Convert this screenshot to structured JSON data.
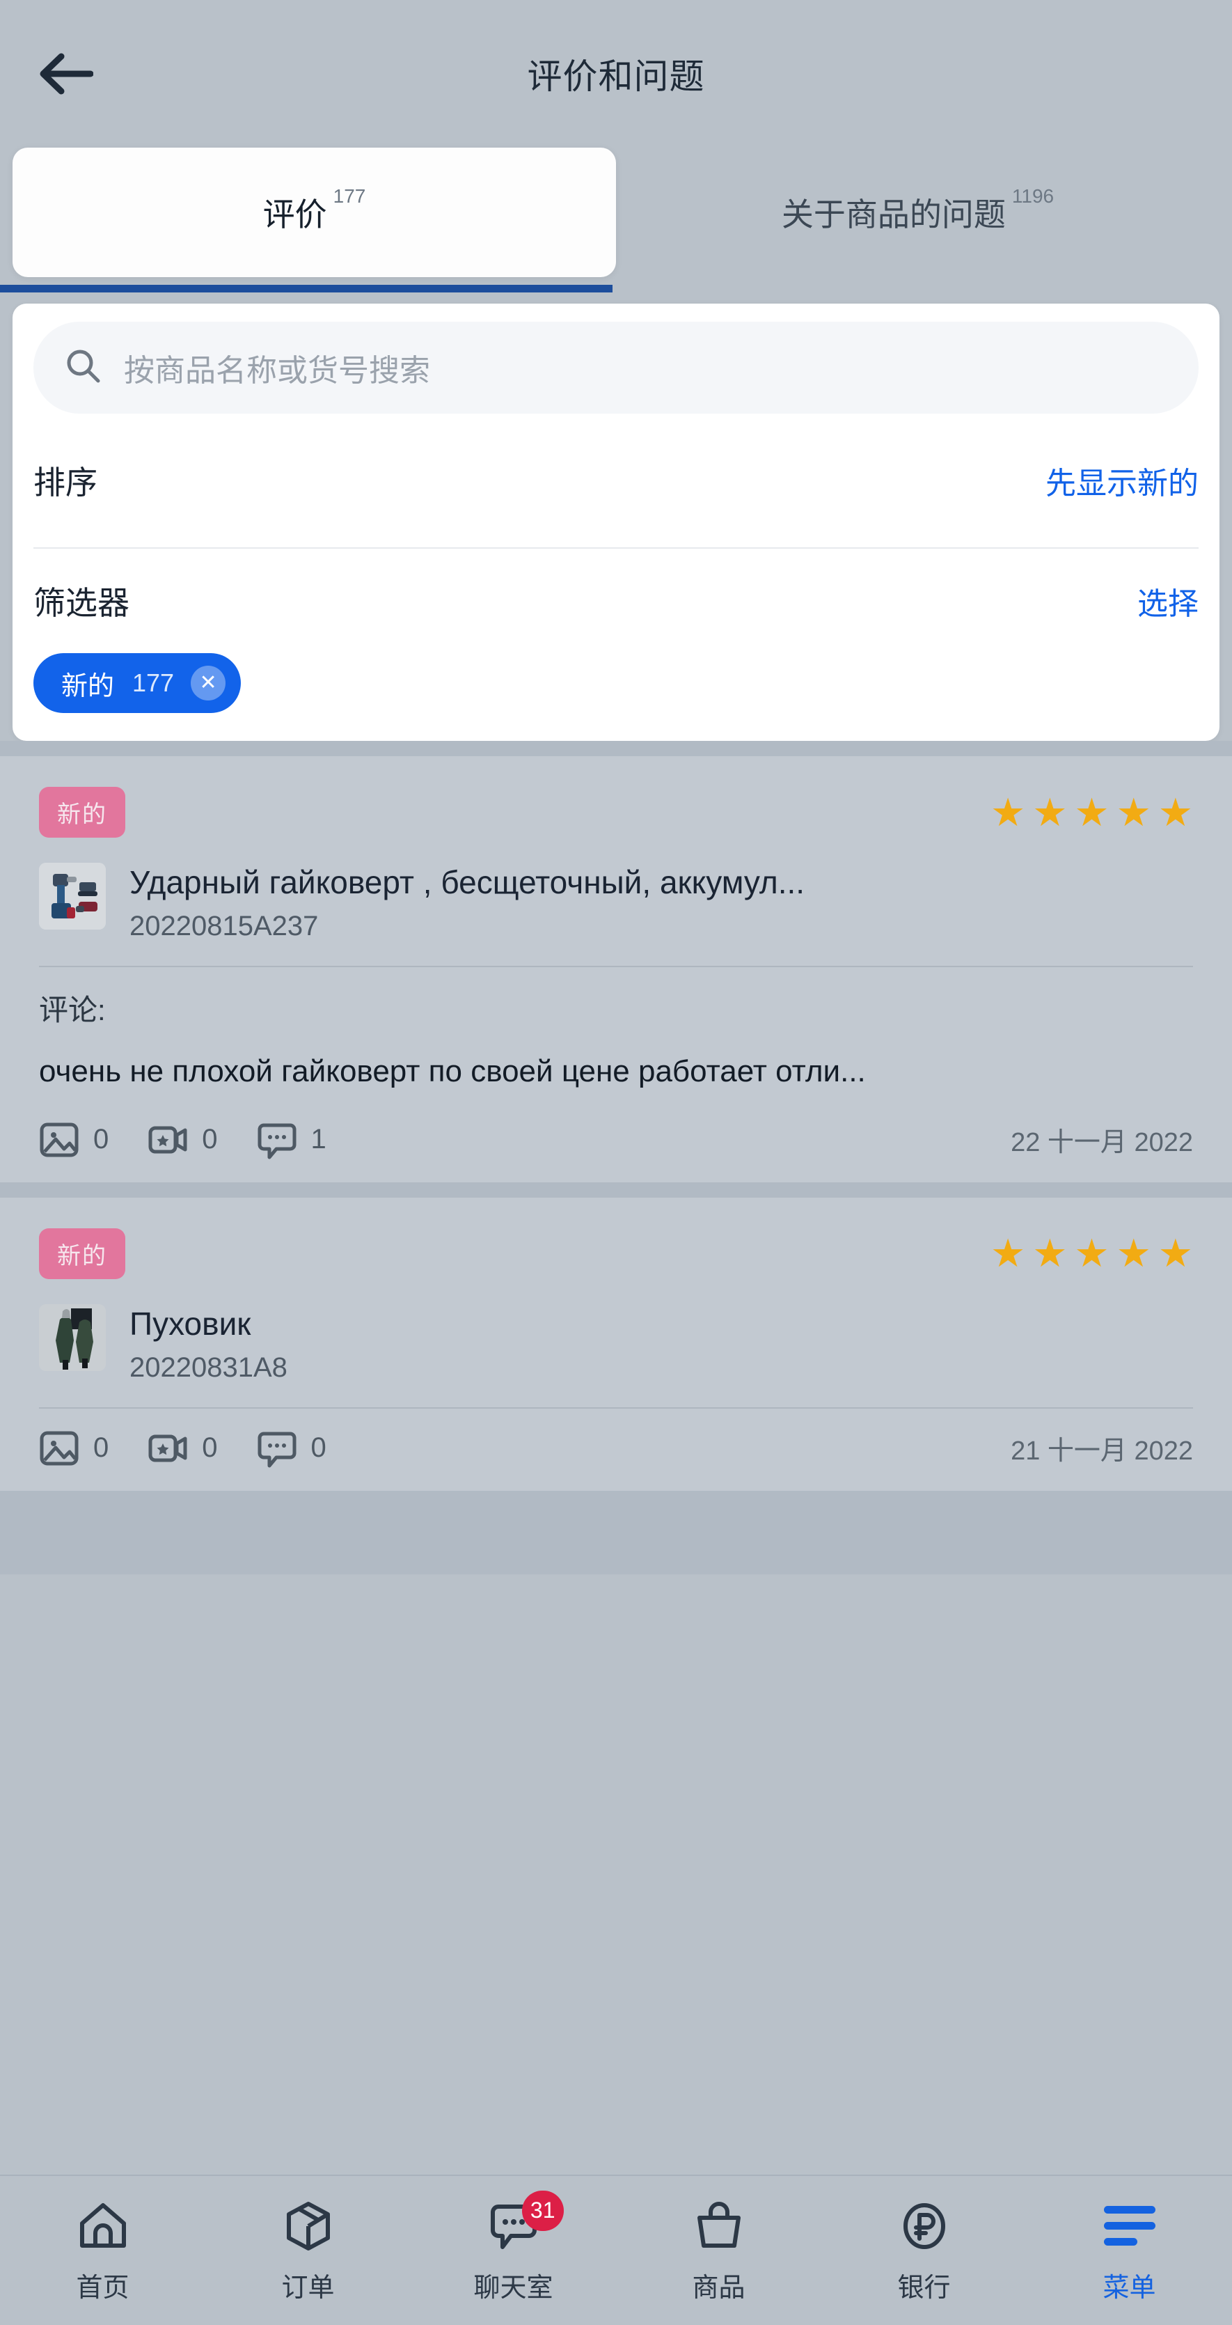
{
  "header": {
    "back_icon": "back-arrow-icon",
    "title": "评价和问题"
  },
  "tabs": [
    {
      "label": "评价",
      "count": "177",
      "active": true
    },
    {
      "label": "关于商品的问题",
      "count": "1196",
      "active": false
    }
  ],
  "filter_panel": {
    "search": {
      "icon": "search-icon",
      "placeholder": "按商品名称或货号搜索",
      "value": ""
    },
    "sort": {
      "label": "排序",
      "value": "先显示新的"
    },
    "filters": {
      "label": "筛选器",
      "action": "选择"
    },
    "chips": [
      {
        "label": "新的",
        "count": "177",
        "close_icon": "close-icon"
      }
    ]
  },
  "reviews": [
    {
      "badge": "新的",
      "rating": 5,
      "stars": "★★★★★",
      "thumb": "impact-wrench-photo",
      "product_name": "Ударный гайковерт , бесщеточный, аккумул...",
      "sku": "20220815A237",
      "comment_label": "评论:",
      "comment_text": "очень не плохой гайковерт по своей цене работает отли...",
      "photos": "0",
      "videos": "0",
      "replies": "1",
      "date": "22 十一月 2022"
    },
    {
      "badge": "新的",
      "rating": 5,
      "stars": "★★★★★",
      "thumb": "down-jacket-photo",
      "product_name": "Пуховик",
      "sku": "20220831A8",
      "comment_label": "",
      "comment_text": "",
      "photos": "0",
      "videos": "0",
      "replies": "0",
      "date": "21 十一月 2022"
    }
  ],
  "bottom_nav": [
    {
      "label": "首页",
      "icon": "home-icon",
      "badge": "",
      "active": false
    },
    {
      "label": "订单",
      "icon": "box-icon",
      "badge": "",
      "active": false
    },
    {
      "label": "聊天室",
      "icon": "chat-bubble-icon",
      "badge": "31",
      "active": false
    },
    {
      "label": "商品",
      "icon": "shopping-bag-icon",
      "badge": "",
      "active": false
    },
    {
      "label": "银行",
      "icon": "ruble-coin-icon",
      "badge": "",
      "active": false
    },
    {
      "label": "菜单",
      "icon": "hamburger-menu-icon",
      "badge": "",
      "active": true
    }
  ],
  "colors": {
    "page_bg": "#b9c1c9",
    "accent_blue": "#1262ea",
    "tab_underline": "#1d4e9c",
    "badge_pink": "#e2769d",
    "star_gold": "#f2ab13",
    "nav_badge_red": "#dc1f46"
  }
}
